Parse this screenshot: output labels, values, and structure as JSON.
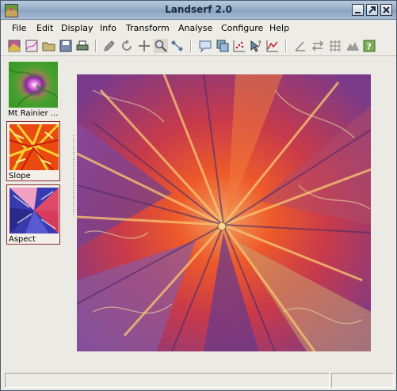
{
  "window": {
    "title": "Landserf 2.0"
  },
  "title_buttons": [
    {
      "name": "minimize-icon"
    },
    {
      "name": "maximize-icon"
    },
    {
      "name": "close-icon"
    }
  ],
  "menu": [
    {
      "label": "File"
    },
    {
      "label": "Edit"
    },
    {
      "label": "Display"
    },
    {
      "label": "Info"
    },
    {
      "label": "Transform"
    },
    {
      "label": "Analyse"
    },
    {
      "label": "Configure"
    },
    {
      "label": "Help"
    }
  ],
  "toolbar": {
    "tools": [
      "new-raster-icon",
      "new-vector-icon",
      "open-icon",
      "save-icon",
      "print-icon",
      "edit-pencil-icon",
      "refresh-icon",
      "pan-icon",
      "zoom-icon",
      "network-icon",
      "speech-bubble-icon",
      "layers-icon",
      "scatter-icon",
      "query-icon",
      "profile-icon",
      "angle-icon",
      "transfer-icon",
      "grid-icon",
      "terrain-icon",
      "help-icon"
    ]
  },
  "thumbnails": [
    {
      "label": "Mt Rainier ...",
      "selected": false
    },
    {
      "label": "Slope",
      "selected": true
    },
    {
      "label": "Aspect",
      "selected": true
    }
  ],
  "status": {
    "left": "",
    "right": ""
  }
}
